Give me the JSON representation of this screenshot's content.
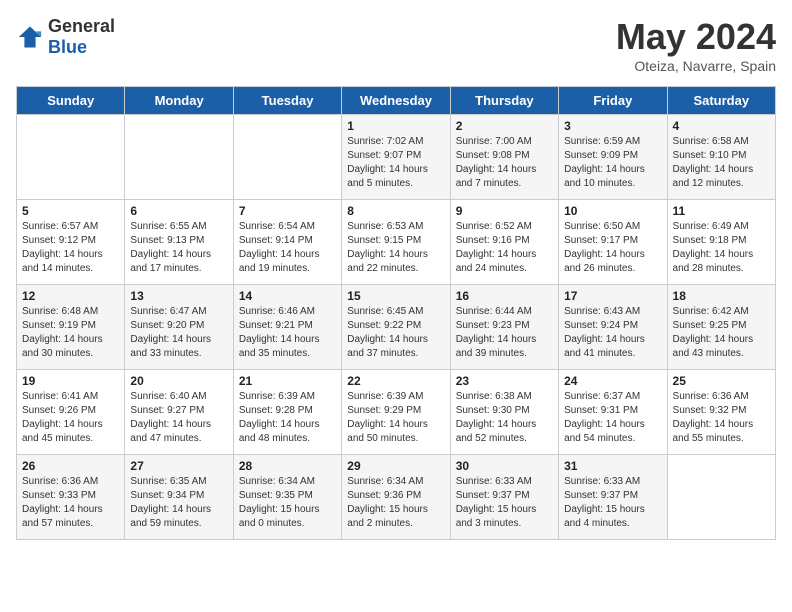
{
  "logo": {
    "general": "General",
    "blue": "Blue"
  },
  "title": "May 2024",
  "subtitle": "Oteiza, Navarre, Spain",
  "days_of_week": [
    "Sunday",
    "Monday",
    "Tuesday",
    "Wednesday",
    "Thursday",
    "Friday",
    "Saturday"
  ],
  "weeks": [
    [
      {
        "day": "",
        "info": ""
      },
      {
        "day": "",
        "info": ""
      },
      {
        "day": "",
        "info": ""
      },
      {
        "day": "1",
        "info": "Sunrise: 7:02 AM\nSunset: 9:07 PM\nDaylight: 14 hours\nand 5 minutes."
      },
      {
        "day": "2",
        "info": "Sunrise: 7:00 AM\nSunset: 9:08 PM\nDaylight: 14 hours\nand 7 minutes."
      },
      {
        "day": "3",
        "info": "Sunrise: 6:59 AM\nSunset: 9:09 PM\nDaylight: 14 hours\nand 10 minutes."
      },
      {
        "day": "4",
        "info": "Sunrise: 6:58 AM\nSunset: 9:10 PM\nDaylight: 14 hours\nand 12 minutes."
      }
    ],
    [
      {
        "day": "5",
        "info": "Sunrise: 6:57 AM\nSunset: 9:12 PM\nDaylight: 14 hours\nand 14 minutes."
      },
      {
        "day": "6",
        "info": "Sunrise: 6:55 AM\nSunset: 9:13 PM\nDaylight: 14 hours\nand 17 minutes."
      },
      {
        "day": "7",
        "info": "Sunrise: 6:54 AM\nSunset: 9:14 PM\nDaylight: 14 hours\nand 19 minutes."
      },
      {
        "day": "8",
        "info": "Sunrise: 6:53 AM\nSunset: 9:15 PM\nDaylight: 14 hours\nand 22 minutes."
      },
      {
        "day": "9",
        "info": "Sunrise: 6:52 AM\nSunset: 9:16 PM\nDaylight: 14 hours\nand 24 minutes."
      },
      {
        "day": "10",
        "info": "Sunrise: 6:50 AM\nSunset: 9:17 PM\nDaylight: 14 hours\nand 26 minutes."
      },
      {
        "day": "11",
        "info": "Sunrise: 6:49 AM\nSunset: 9:18 PM\nDaylight: 14 hours\nand 28 minutes."
      }
    ],
    [
      {
        "day": "12",
        "info": "Sunrise: 6:48 AM\nSunset: 9:19 PM\nDaylight: 14 hours\nand 30 minutes."
      },
      {
        "day": "13",
        "info": "Sunrise: 6:47 AM\nSunset: 9:20 PM\nDaylight: 14 hours\nand 33 minutes."
      },
      {
        "day": "14",
        "info": "Sunrise: 6:46 AM\nSunset: 9:21 PM\nDaylight: 14 hours\nand 35 minutes."
      },
      {
        "day": "15",
        "info": "Sunrise: 6:45 AM\nSunset: 9:22 PM\nDaylight: 14 hours\nand 37 minutes."
      },
      {
        "day": "16",
        "info": "Sunrise: 6:44 AM\nSunset: 9:23 PM\nDaylight: 14 hours\nand 39 minutes."
      },
      {
        "day": "17",
        "info": "Sunrise: 6:43 AM\nSunset: 9:24 PM\nDaylight: 14 hours\nand 41 minutes."
      },
      {
        "day": "18",
        "info": "Sunrise: 6:42 AM\nSunset: 9:25 PM\nDaylight: 14 hours\nand 43 minutes."
      }
    ],
    [
      {
        "day": "19",
        "info": "Sunrise: 6:41 AM\nSunset: 9:26 PM\nDaylight: 14 hours\nand 45 minutes."
      },
      {
        "day": "20",
        "info": "Sunrise: 6:40 AM\nSunset: 9:27 PM\nDaylight: 14 hours\nand 47 minutes."
      },
      {
        "day": "21",
        "info": "Sunrise: 6:39 AM\nSunset: 9:28 PM\nDaylight: 14 hours\nand 48 minutes."
      },
      {
        "day": "22",
        "info": "Sunrise: 6:39 AM\nSunset: 9:29 PM\nDaylight: 14 hours\nand 50 minutes."
      },
      {
        "day": "23",
        "info": "Sunrise: 6:38 AM\nSunset: 9:30 PM\nDaylight: 14 hours\nand 52 minutes."
      },
      {
        "day": "24",
        "info": "Sunrise: 6:37 AM\nSunset: 9:31 PM\nDaylight: 14 hours\nand 54 minutes."
      },
      {
        "day": "25",
        "info": "Sunrise: 6:36 AM\nSunset: 9:32 PM\nDaylight: 14 hours\nand 55 minutes."
      }
    ],
    [
      {
        "day": "26",
        "info": "Sunrise: 6:36 AM\nSunset: 9:33 PM\nDaylight: 14 hours\nand 57 minutes."
      },
      {
        "day": "27",
        "info": "Sunrise: 6:35 AM\nSunset: 9:34 PM\nDaylight: 14 hours\nand 59 minutes."
      },
      {
        "day": "28",
        "info": "Sunrise: 6:34 AM\nSunset: 9:35 PM\nDaylight: 15 hours\nand 0 minutes."
      },
      {
        "day": "29",
        "info": "Sunrise: 6:34 AM\nSunset: 9:36 PM\nDaylight: 15 hours\nand 2 minutes."
      },
      {
        "day": "30",
        "info": "Sunrise: 6:33 AM\nSunset: 9:37 PM\nDaylight: 15 hours\nand 3 minutes."
      },
      {
        "day": "31",
        "info": "Sunrise: 6:33 AM\nSunset: 9:37 PM\nDaylight: 15 hours\nand 4 minutes."
      },
      {
        "day": "",
        "info": ""
      }
    ]
  ]
}
